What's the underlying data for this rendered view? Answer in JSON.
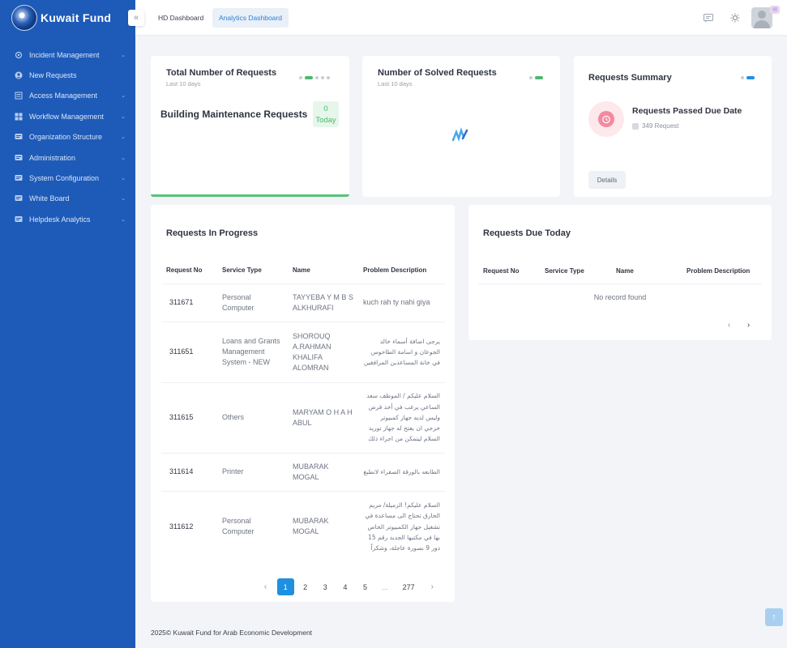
{
  "brand": {
    "name": "Kuwait Fund"
  },
  "sidebar": {
    "items": [
      {
        "label": "Incident Management",
        "icon": "incident-icon",
        "has_children": true
      },
      {
        "label": "New Requests",
        "icon": "user-icon",
        "has_children": false
      },
      {
        "label": "Access Management",
        "icon": "access-icon",
        "has_children": true
      },
      {
        "label": "Workflow Management",
        "icon": "workflow-icon",
        "has_children": true
      },
      {
        "label": "Organization Structure",
        "icon": "organization-icon",
        "has_children": true
      },
      {
        "label": "Administration",
        "icon": "administration-icon",
        "has_children": true
      },
      {
        "label": "System Configuration",
        "icon": "configuration-icon",
        "has_children": true
      },
      {
        "label": "White Board",
        "icon": "whiteboard-icon",
        "has_children": true
      },
      {
        "label": "Helpdesk Analytics",
        "icon": "analytics-icon",
        "has_children": true
      }
    ]
  },
  "topbar": {
    "tabs": [
      {
        "label": "HD Dashboard",
        "active": false
      },
      {
        "label": "Analytics Dashboard",
        "active": true
      }
    ]
  },
  "cards": {
    "total": {
      "title": "Total Number of Requests",
      "subtitle": "Last 10 days",
      "item_label": "Building Maintenance Requests",
      "count": "0",
      "count_label": "Today"
    },
    "solved": {
      "title": "Number of Solved Requests",
      "subtitle": "Last 10 days"
    },
    "summary": {
      "title": "Requests Summary",
      "item_title": "Requests Passed Due Date",
      "item_count": "349 Request",
      "details_label": "Details"
    }
  },
  "in_progress": {
    "title": "Requests In Progress",
    "columns": [
      "Request No",
      "Service Type",
      "Name",
      "Problem Description"
    ],
    "rows": [
      {
        "no": "311671",
        "type": "Personal Computer",
        "name": "TAYYEBA Y M B S ALKHURAFI",
        "desc": "kuch rah ty nahi giya"
      },
      {
        "no": "311651",
        "type": "Loans and Grants Management System - NEW",
        "name": "SHOROUQ A.RAHMAN KHALIFA ALOMRAN",
        "desc": "يرجى اضافة أسماء خالد الجوعان و اسامة الطاحوس في خانة المساعدين المرافقين"
      },
      {
        "no": "311615",
        "type": "Others",
        "name": "MARYAM O H A H ABUL",
        "desc": "السلام عليكم / الموظف سعد الساعي يرغب في أخذ قرض وليس لديه جهاز كمبيوتر خزجي ان يفتح له جهاز توريد السلام ليتمكن من اجراء ذلك"
      },
      {
        "no": "311614",
        "type": "Printer",
        "name": "MUBARAK MOGAL",
        "desc": "الطابعه بالورقة الصفراء لاتطبع"
      },
      {
        "no": "311612",
        "type": "Personal Computer",
        "name": "MUBARAK MOGAL",
        "desc": "السلام عليكم! الزميلة/ مريم الخارق تحتاج الى مساعدة في تشغيل جهاز الكمبيوتر الخاص بها في مكتبها الجديد رقم 15 دور 9 بصورة عاجلة، وشكراً"
      }
    ],
    "pages": [
      "1",
      "2",
      "3",
      "4",
      "5",
      "...",
      "277"
    ],
    "active_page": "1"
  },
  "due_today": {
    "title": "Requests Due Today",
    "columns": [
      "Request No",
      "Service Type",
      "Name",
      "Problem Description"
    ],
    "empty_text": "No record found"
  },
  "footer": {
    "text": "2025© Kuwait Fund for Arab Economic Development"
  },
  "colors": {
    "sidebar": "#1e5bb8",
    "accent": "#1f8fe0",
    "success": "#58c27a",
    "danger": "#f28a9f"
  }
}
